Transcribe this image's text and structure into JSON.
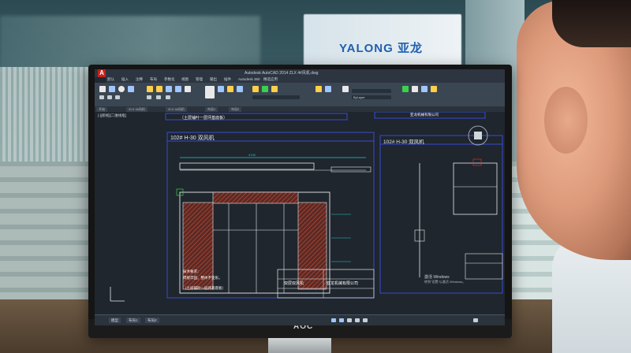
{
  "background": {
    "sign_text": "YALONG 亚龙"
  },
  "monitor": {
    "brand": "AOC"
  },
  "app": {
    "logo": "A",
    "title": "Autodesk AutoCAD 2014   ZLX 4#风机.dwg",
    "menu": [
      "默认",
      "插入",
      "注释",
      "布局",
      "参数化",
      "视图",
      "管理",
      "输出",
      "插件",
      "Autodesk 360",
      "精选应用"
    ],
    "file_tabs": [
      "开始",
      "ZLX 4#风机",
      "ZLX 4#风机",
      "布局1",
      "布局2"
    ],
    "viewport_label": "[-][俯视][二维线框]",
    "layer_name": "ByLayer",
    "colors": {
      "screen_bg": "#1f262d",
      "line_white": "#e8ecef",
      "line_blue": "#3a49d6",
      "line_yellow": "#ffe24a",
      "line_green": "#39d24a",
      "line_cyan": "#29c6d0",
      "hatch": "#b03a2e",
      "red_mark": "#ff2a2a"
    }
  },
  "drawing": {
    "top_note": "（土层铺叶一层坪基底板）",
    "left_title": "102# H-30 双风机",
    "right_title": "102# H-30 双风机",
    "dim_width": "4740",
    "notes": [
      "技术要求：",
      "焊接牢固，整体不变形。",
      "（土层铺叶一层坪基底板）"
    ],
    "title_block_left": "双层双风机",
    "title_block_company": "亚龙机械有限公司",
    "top_company": "亚龙机械有限公司",
    "watermark_line1": "激活 Windows",
    "watermark_line2": "转到\"设置\"以激活 Windows。"
  },
  "statusbar": {
    "tabs": [
      "模型",
      "布局1",
      "布局2"
    ]
  }
}
